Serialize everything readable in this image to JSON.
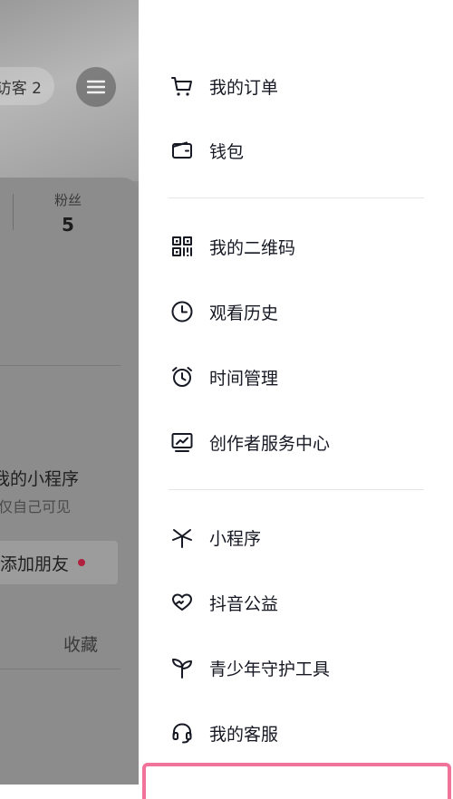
{
  "background": {
    "visitor_label": "访客 2",
    "fans_label": "粉丝",
    "fans_count": "5",
    "mini_program_title": "我的小程序",
    "mini_program_sub": "仅自己可见",
    "add_friend_label": "添加朋友",
    "collect_label": "收藏"
  },
  "drawer": {
    "groups": [
      {
        "items": [
          {
            "label": "我的订单",
            "icon": "cart-icon"
          },
          {
            "label": "钱包",
            "icon": "wallet-icon"
          }
        ]
      },
      {
        "items": [
          {
            "label": "我的二维码",
            "icon": "qr-code-icon"
          },
          {
            "label": "观看历史",
            "icon": "clock-icon"
          },
          {
            "label": "时间管理",
            "icon": "alarm-icon"
          },
          {
            "label": "创作者服务中心",
            "icon": "chart-monitor-icon"
          }
        ]
      },
      {
        "items": [
          {
            "label": "小程序",
            "icon": "mini-program-icon"
          },
          {
            "label": "抖音公益",
            "icon": "charity-heart-icon"
          },
          {
            "label": "青少年守护工具",
            "icon": "sprout-icon"
          },
          {
            "label": "我的客服",
            "icon": "headset-icon"
          }
        ]
      }
    ]
  },
  "colors": {
    "highlight_border": "#f07499",
    "notify_dot": "#b0213f",
    "text_primary": "#161823"
  }
}
